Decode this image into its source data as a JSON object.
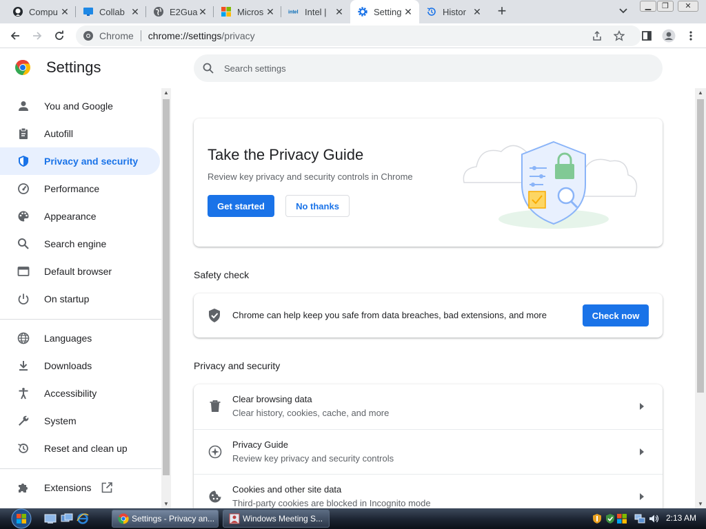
{
  "browser": {
    "tabs": [
      {
        "title": "Compu",
        "icon": "github-icon",
        "active": false
      },
      {
        "title": "Collab",
        "icon": "monitor-icon",
        "active": false
      },
      {
        "title": "E2Gua",
        "icon": "globe-icon",
        "active": false
      },
      {
        "title": "Micros",
        "icon": "microsoft-logo-icon",
        "active": false
      },
      {
        "title": "Intel |",
        "icon": "intel-logo-icon",
        "active": false
      },
      {
        "title": "Setting",
        "icon": "gear-icon",
        "active": true
      },
      {
        "title": "Histor",
        "icon": "history-icon",
        "active": false
      }
    ],
    "address": {
      "site_label": "Chrome",
      "url_host": "chrome://settings",
      "url_path": "/privacy"
    },
    "accent": "#1a73e8"
  },
  "settings": {
    "title": "Settings",
    "search_placeholder": "Search settings",
    "nav": [
      {
        "label": "You and Google",
        "icon": "person-icon"
      },
      {
        "label": "Autofill",
        "icon": "clipboard-icon"
      },
      {
        "label": "Privacy and security",
        "icon": "shield-icon"
      },
      {
        "label": "Performance",
        "icon": "speedometer-icon"
      },
      {
        "label": "Appearance",
        "icon": "palette-icon"
      },
      {
        "label": "Search engine",
        "icon": "search-icon"
      },
      {
        "label": "Default browser",
        "icon": "browser-window-icon"
      },
      {
        "label": "On startup",
        "icon": "power-icon"
      },
      {
        "label": "Languages",
        "icon": "globe-icon"
      },
      {
        "label": "Downloads",
        "icon": "download-icon"
      },
      {
        "label": "Accessibility",
        "icon": "accessibility-icon"
      },
      {
        "label": "System",
        "icon": "wrench-icon"
      },
      {
        "label": "Reset and clean up",
        "icon": "history-icon"
      },
      {
        "label": "Extensions",
        "icon": "puzzle-icon"
      }
    ],
    "active_nav": "Privacy and security",
    "privacy_guide": {
      "title": "Take the Privacy Guide",
      "description": "Review key privacy and security controls in Chrome",
      "get_started": "Get started",
      "no_thanks": "No thanks"
    },
    "safety_check": {
      "section_title": "Safety check",
      "text": "Chrome can help keep you safe from data breaches, bad extensions, and more",
      "button": "Check now"
    },
    "privacy_section": {
      "title": "Privacy and security",
      "rows": [
        {
          "title": "Clear browsing data",
          "subtitle": "Clear history, cookies, cache, and more",
          "icon": "trash-icon"
        },
        {
          "title": "Privacy Guide",
          "subtitle": "Review key privacy and security controls",
          "icon": "compass-icon"
        },
        {
          "title": "Cookies and other site data",
          "subtitle": "Third-party cookies are blocked in Incognito mode",
          "icon": "cookie-icon"
        }
      ]
    }
  },
  "taskbar": {
    "buttons": [
      {
        "label": "Settings - Privacy an...",
        "icon": "chrome-icon"
      },
      {
        "label": "Windows Meeting S...",
        "icon": "meeting-icon"
      }
    ],
    "clock": "2:13 AM"
  }
}
